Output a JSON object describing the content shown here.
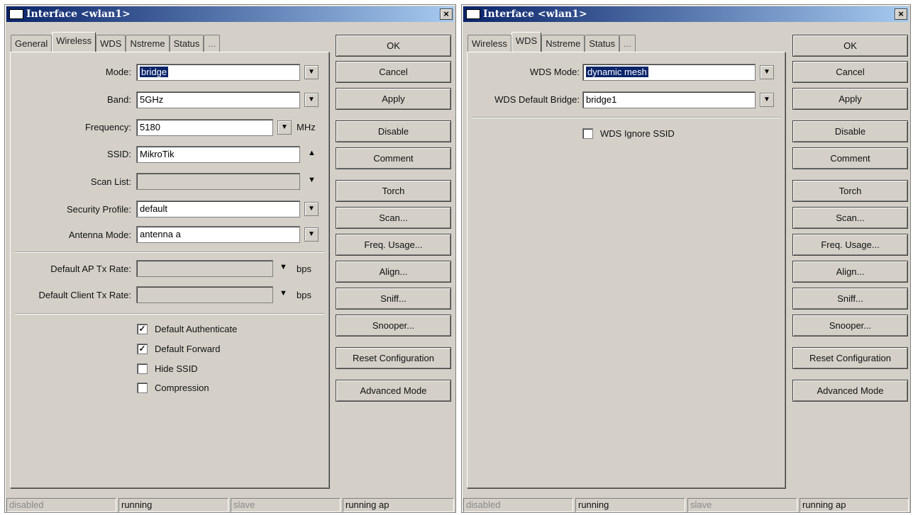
{
  "left_window": {
    "title": "Interface <wlan1>",
    "close_label": "×",
    "tabs": [
      "General",
      "Wireless",
      "WDS",
      "Nstreme",
      "Status",
      "..."
    ],
    "active_tab": "Wireless",
    "fields": {
      "mode": {
        "label": "Mode:",
        "value": "bridge"
      },
      "band": {
        "label": "Band:",
        "value": "5GHz"
      },
      "frequency": {
        "label": "Frequency:",
        "value": "5180",
        "unit": "MHz"
      },
      "ssid": {
        "label": "SSID:",
        "value": "MikroTik"
      },
      "scan_list": {
        "label": "Scan List:",
        "value": ""
      },
      "security_profile": {
        "label": "Security Profile:",
        "value": "default"
      },
      "antenna_mode": {
        "label": "Antenna Mode:",
        "value": "antenna a"
      },
      "default_ap_tx_rate": {
        "label": "Default AP Tx Rate:",
        "value": "",
        "unit": "bps"
      },
      "default_client_tx_rate": {
        "label": "Default Client Tx Rate:",
        "value": "",
        "unit": "bps"
      }
    },
    "checkboxes": [
      {
        "label": "Default Authenticate",
        "checked": true
      },
      {
        "label": "Default Forward",
        "checked": true
      },
      {
        "label": "Hide SSID",
        "checked": false
      },
      {
        "label": "Compression",
        "checked": false
      }
    ],
    "buttons": [
      "OK",
      "Cancel",
      "Apply",
      "Disable",
      "Comment",
      "Torch",
      "Scan...",
      "Freq. Usage...",
      "Align...",
      "Sniff...",
      "Snooper...",
      "Reset Configuration",
      "Advanced Mode"
    ],
    "status": [
      "disabled",
      "running",
      "slave",
      "running ap"
    ]
  },
  "right_window": {
    "title": "Interface <wlan1>",
    "close_label": "×",
    "tabs": [
      "Wireless",
      "WDS",
      "Nstreme",
      "Status",
      "..."
    ],
    "active_tab": "WDS",
    "fields": {
      "wds_mode": {
        "label": "WDS Mode:",
        "value": "dynamic mesh"
      },
      "wds_default_bridge": {
        "label": "WDS Default Bridge:",
        "value": "bridge1"
      }
    },
    "checkboxes": [
      {
        "label": "WDS Ignore SSID",
        "checked": false
      }
    ],
    "buttons": [
      "OK",
      "Cancel",
      "Apply",
      "Disable",
      "Comment",
      "Torch",
      "Scan...",
      "Freq. Usage...",
      "Align...",
      "Sniff...",
      "Snooper...",
      "Reset Configuration",
      "Advanced Mode"
    ],
    "status": [
      "disabled",
      "running",
      "slave",
      "running ap"
    ]
  },
  "colors": {
    "titlebar_start": "#0a246a",
    "titlebar_end": "#a6caf0",
    "window_bg": "#d4d0c8",
    "selection": "#0a246a"
  }
}
